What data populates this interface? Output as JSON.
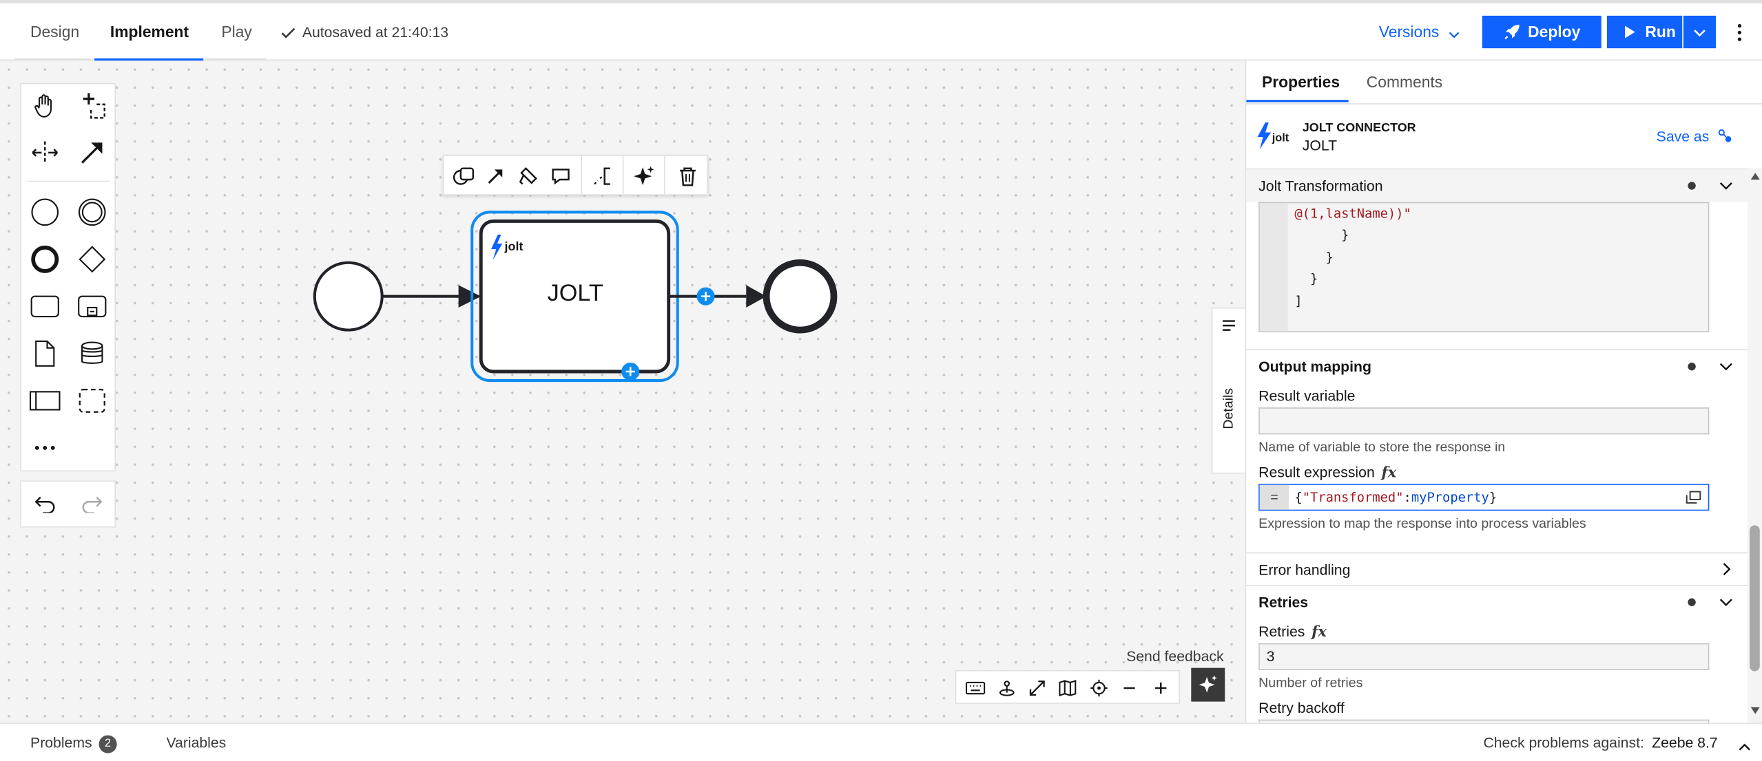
{
  "top_bar": {
    "mode_tabs": [
      {
        "label": "Design",
        "active": false
      },
      {
        "label": "Implement",
        "active": true
      },
      {
        "label": "Play",
        "active": false
      }
    ],
    "autosave_text": "Autosaved at 21:40:13",
    "versions_label": "Versions",
    "deploy_label": "Deploy",
    "run_label": "Run"
  },
  "palette": {
    "tools": [
      "hand-tool-icon",
      "lasso-tool-icon",
      "space-tool-icon",
      "connect-tool-icon"
    ],
    "shapes": [
      "start-event-icon",
      "intermediate-event-icon",
      "end-event-icon",
      "gateway-icon",
      "task-icon",
      "subprocess-icon",
      "data-object-icon",
      "data-store-icon",
      "pool-icon",
      "group-icon",
      "more-icon"
    ]
  },
  "diagram": {
    "task_name": "JOLT",
    "task_logo_text": "jolt"
  },
  "details_tab_label": "Details",
  "send_feedback_label": "Send feedback",
  "properties": {
    "tabs": [
      {
        "label": "Properties",
        "active": true
      },
      {
        "label": "Comments",
        "active": false
      }
    ],
    "element_type": "JOLT CONNECTOR",
    "element_name": "JOLT",
    "save_as_label": "Save as",
    "groups": {
      "jolt_transformation": "Jolt Transformation",
      "output_mapping": "Output mapping",
      "error_handling": "Error handling",
      "retries": "Retries"
    },
    "code_lines": [
      "@(1,lastName))\"",
      "      }",
      "    }",
      "  }",
      "]"
    ],
    "result_variable_label": "Result variable",
    "result_variable_value": "",
    "result_variable_help": "Name of variable to store the response in",
    "result_expression_label": "Result expression",
    "result_expression_eq": "=",
    "result_expression_parts": {
      "open": "{",
      "key": "\"Transformed\"",
      "colon": ":",
      "var": "myProperty",
      "close": "}"
    },
    "result_expression_help": "Expression to map the response into process variables",
    "retries_label": "Retries",
    "retries_value": "3",
    "retries_help": "Number of retries",
    "retry_backoff_label": "Retry backoff"
  },
  "bottom_bar": {
    "problems_label": "Problems",
    "problems_count": "2",
    "variables_label": "Variables",
    "check_label": "Check problems against:",
    "engine_version": "Zeebe 8.7"
  },
  "colors": {
    "accent": "#0f62fe",
    "selection": "#0f8cf0"
  }
}
